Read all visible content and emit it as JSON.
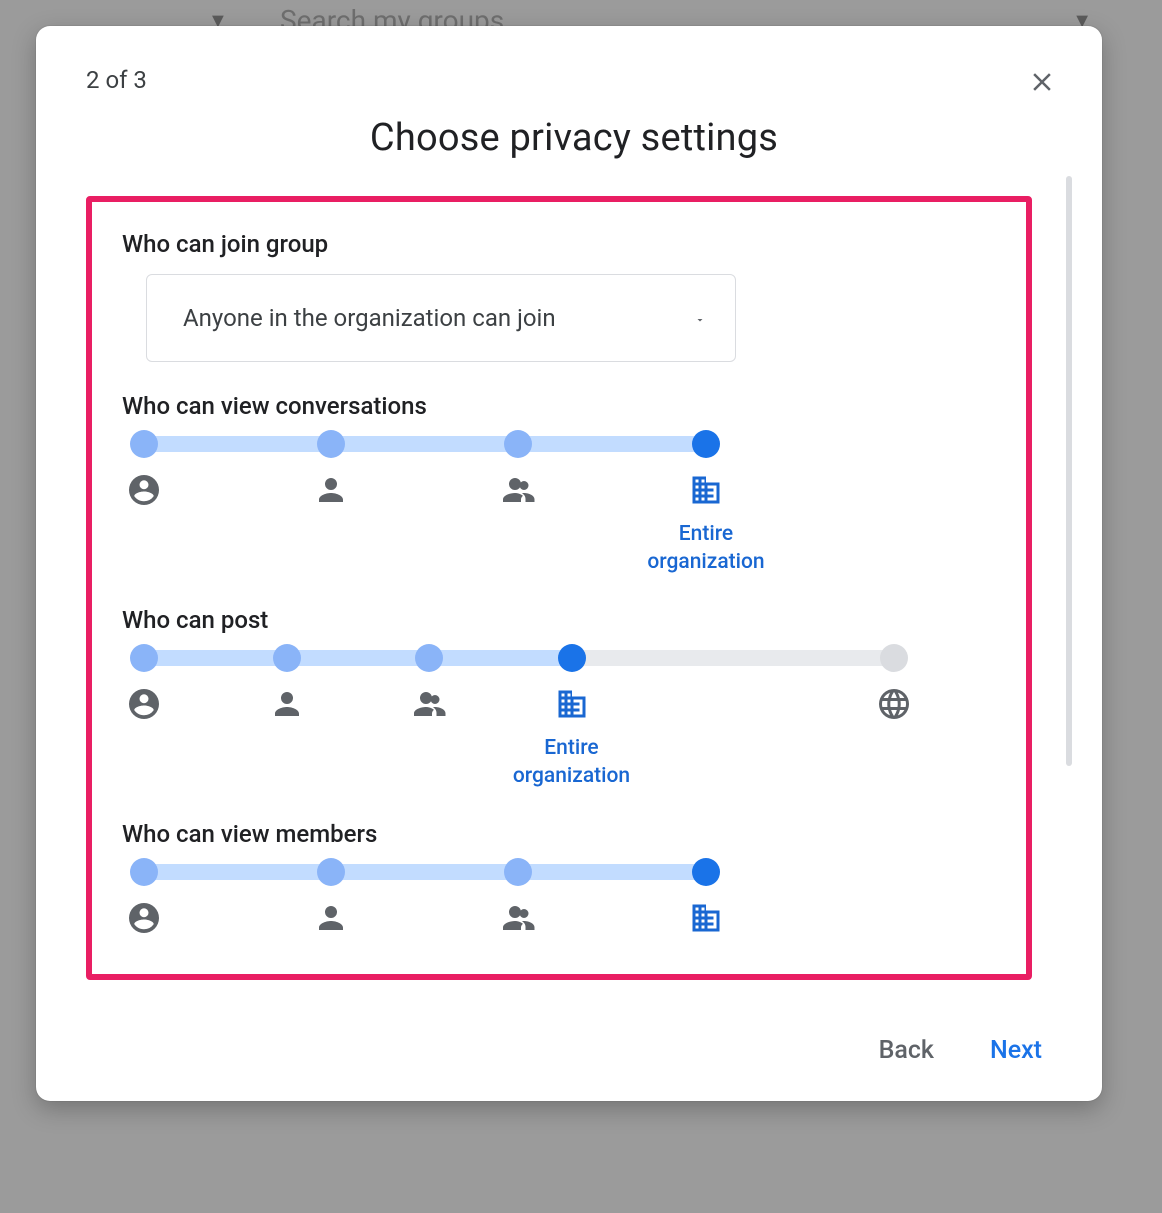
{
  "background": {
    "search_placeholder": "Search my groups"
  },
  "dialog": {
    "step_label": "2 of 3",
    "title": "Choose privacy settings",
    "join": {
      "label": "Who can join group",
      "selected": "Anyone in the organization can join"
    },
    "sliders": {
      "view_conv": {
        "label": "Who can view conversations",
        "options": [
          "Group owners",
          "Group managers",
          "Group members",
          "Entire organization"
        ],
        "selected_index": 3
      },
      "post": {
        "label": "Who can post",
        "options": [
          "Group owners",
          "Group managers",
          "Group members",
          "Entire organization",
          "Anyone on the web"
        ],
        "selected_index": 3
      },
      "view_members": {
        "label": "Who can view members",
        "options": [
          "Group owners",
          "Group managers",
          "Group members",
          "Entire organization"
        ],
        "selected_index": 3
      },
      "selected_label": "Entire organization"
    },
    "buttons": {
      "back": "Back",
      "next": "Next"
    }
  }
}
